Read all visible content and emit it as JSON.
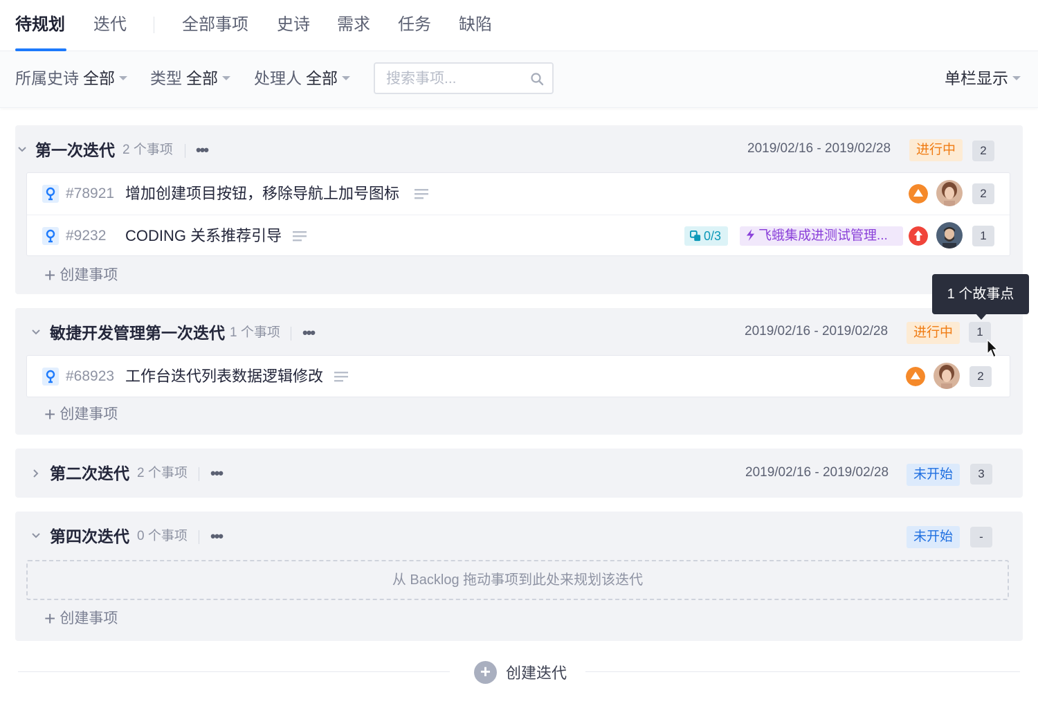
{
  "tabs": {
    "backlog": "待规划",
    "iteration": "迭代",
    "all": "全部事项",
    "epic": "史诗",
    "requirement": "需求",
    "task": "任务",
    "defect": "缺陷"
  },
  "filters": {
    "epic_label": "所属史诗",
    "epic_value": "全部",
    "type_label": "类型",
    "type_value": "全部",
    "assignee_label": "处理人",
    "assignee_value": "全部",
    "search_placeholder": "搜索事项...",
    "view_mode": "单栏显示"
  },
  "iterations": [
    {
      "title": "第一次迭代",
      "count": "2 个事项",
      "dates": "2019/02/16 - 2019/02/28",
      "status": "进行中",
      "points": "2",
      "expanded": true,
      "items": [
        {
          "id": "#78921",
          "title": "增加创建项目按钮，移除导航上加号图标",
          "priority": "medium",
          "points": "2"
        },
        {
          "id": "#9232",
          "title": "CODING 关系推荐引导",
          "subtasks": "0/3",
          "related": "飞蛾集成进测试管理...",
          "priority": "high",
          "points": "1"
        }
      ],
      "create_label": "创建事项"
    },
    {
      "title": "敏捷开发管理第一次迭代",
      "count": "1 个事项",
      "dates": "2019/02/16 - 2019/02/28",
      "status": "进行中",
      "points": "1",
      "expanded": true,
      "items": [
        {
          "id": "#68923",
          "title": "工作台迭代列表数据逻辑修改",
          "priority": "medium",
          "points": "2"
        }
      ],
      "create_label": "创建事项"
    },
    {
      "title": "第二次迭代",
      "count": "2 个事项",
      "dates": "2019/02/16 - 2019/02/28",
      "status": "未开始",
      "points": "3",
      "expanded": false
    },
    {
      "title": "第四次迭代",
      "count": "0 个事项",
      "status": "未开始",
      "points": "-",
      "expanded": true,
      "dropzone": "从 Backlog 拖动事项到此处来规划该迭代",
      "create_label": "创建事项"
    }
  ],
  "tooltip": "1 个故事点",
  "create_iteration": "创建迭代",
  "colors": {
    "accent": "#1d7afc",
    "in_progress": "#f07b12",
    "not_started": "#1f6fe0",
    "priority_medium": "#f5892a",
    "priority_high": "#f0443a"
  }
}
